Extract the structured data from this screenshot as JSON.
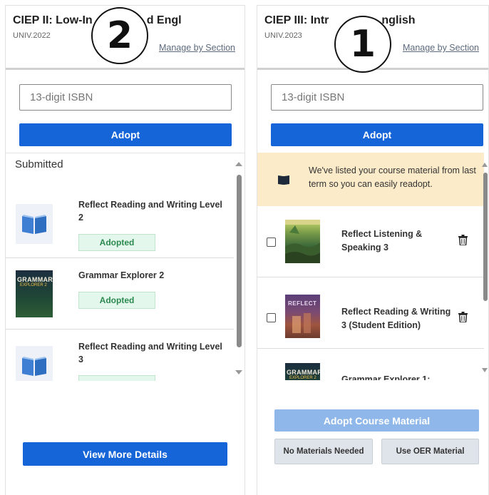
{
  "left_card": {
    "course_title": "CIEP II: Low-In",
    "course_title_end": "d Engl",
    "term": "UNIV.2022",
    "manage_link": "Manage by Section",
    "step_badge": "2",
    "isbn_placeholder": "13-digit ISBN",
    "adopt_label": "Adopt",
    "section_label": "Submitted",
    "books": [
      {
        "title": "Reflect Reading and Writing Level 2",
        "status": "Adopted",
        "cover": "blue-book-icon"
      },
      {
        "title": "Grammar Explorer 2",
        "status": "Adopted",
        "cover": "grammar-explorer-cover",
        "cover_text": "GRAMMAR",
        "cover_sub": "EXPLORER 2"
      },
      {
        "title": "Reflect Reading and Writing Level 3",
        "status": "",
        "cover": "blue-book-icon"
      }
    ],
    "view_more_label": "View More Details"
  },
  "right_card": {
    "course_title": "CIEP III: Intr",
    "course_title_end": "nglish",
    "term": "UNIV.2023",
    "manage_link": "Manage by Section",
    "step_badge": "1",
    "isbn_placeholder": "13-digit ISBN",
    "adopt_label": "Adopt",
    "notice": "We've listed your course material from last term so you can easily readopt.",
    "books": [
      {
        "title": "Reflect Listening & Speaking 3",
        "cover": "reflect-listening-cover"
      },
      {
        "title": "Reflect Reading & Writing 3 (Student Edition)",
        "cover": "reflect-reading-cover",
        "cover_text": "REFLECT"
      },
      {
        "title": "Grammar Explorer 1:",
        "cover": "grammar-explorer-cover",
        "cover_text": "GRAMMAR",
        "cover_sub": "EXPLORER 2"
      }
    ],
    "adopt_course_label": "Adopt Course Material",
    "no_materials_label": "No Materials Needed",
    "oer_label": "Use OER Material"
  },
  "colors": {
    "primary": "#1565d8",
    "primary_disabled": "#8fb7e9",
    "adopted_bg": "#e4f7ec",
    "adopted_text": "#2b8a4f",
    "notice_bg": "#fcebc9"
  }
}
